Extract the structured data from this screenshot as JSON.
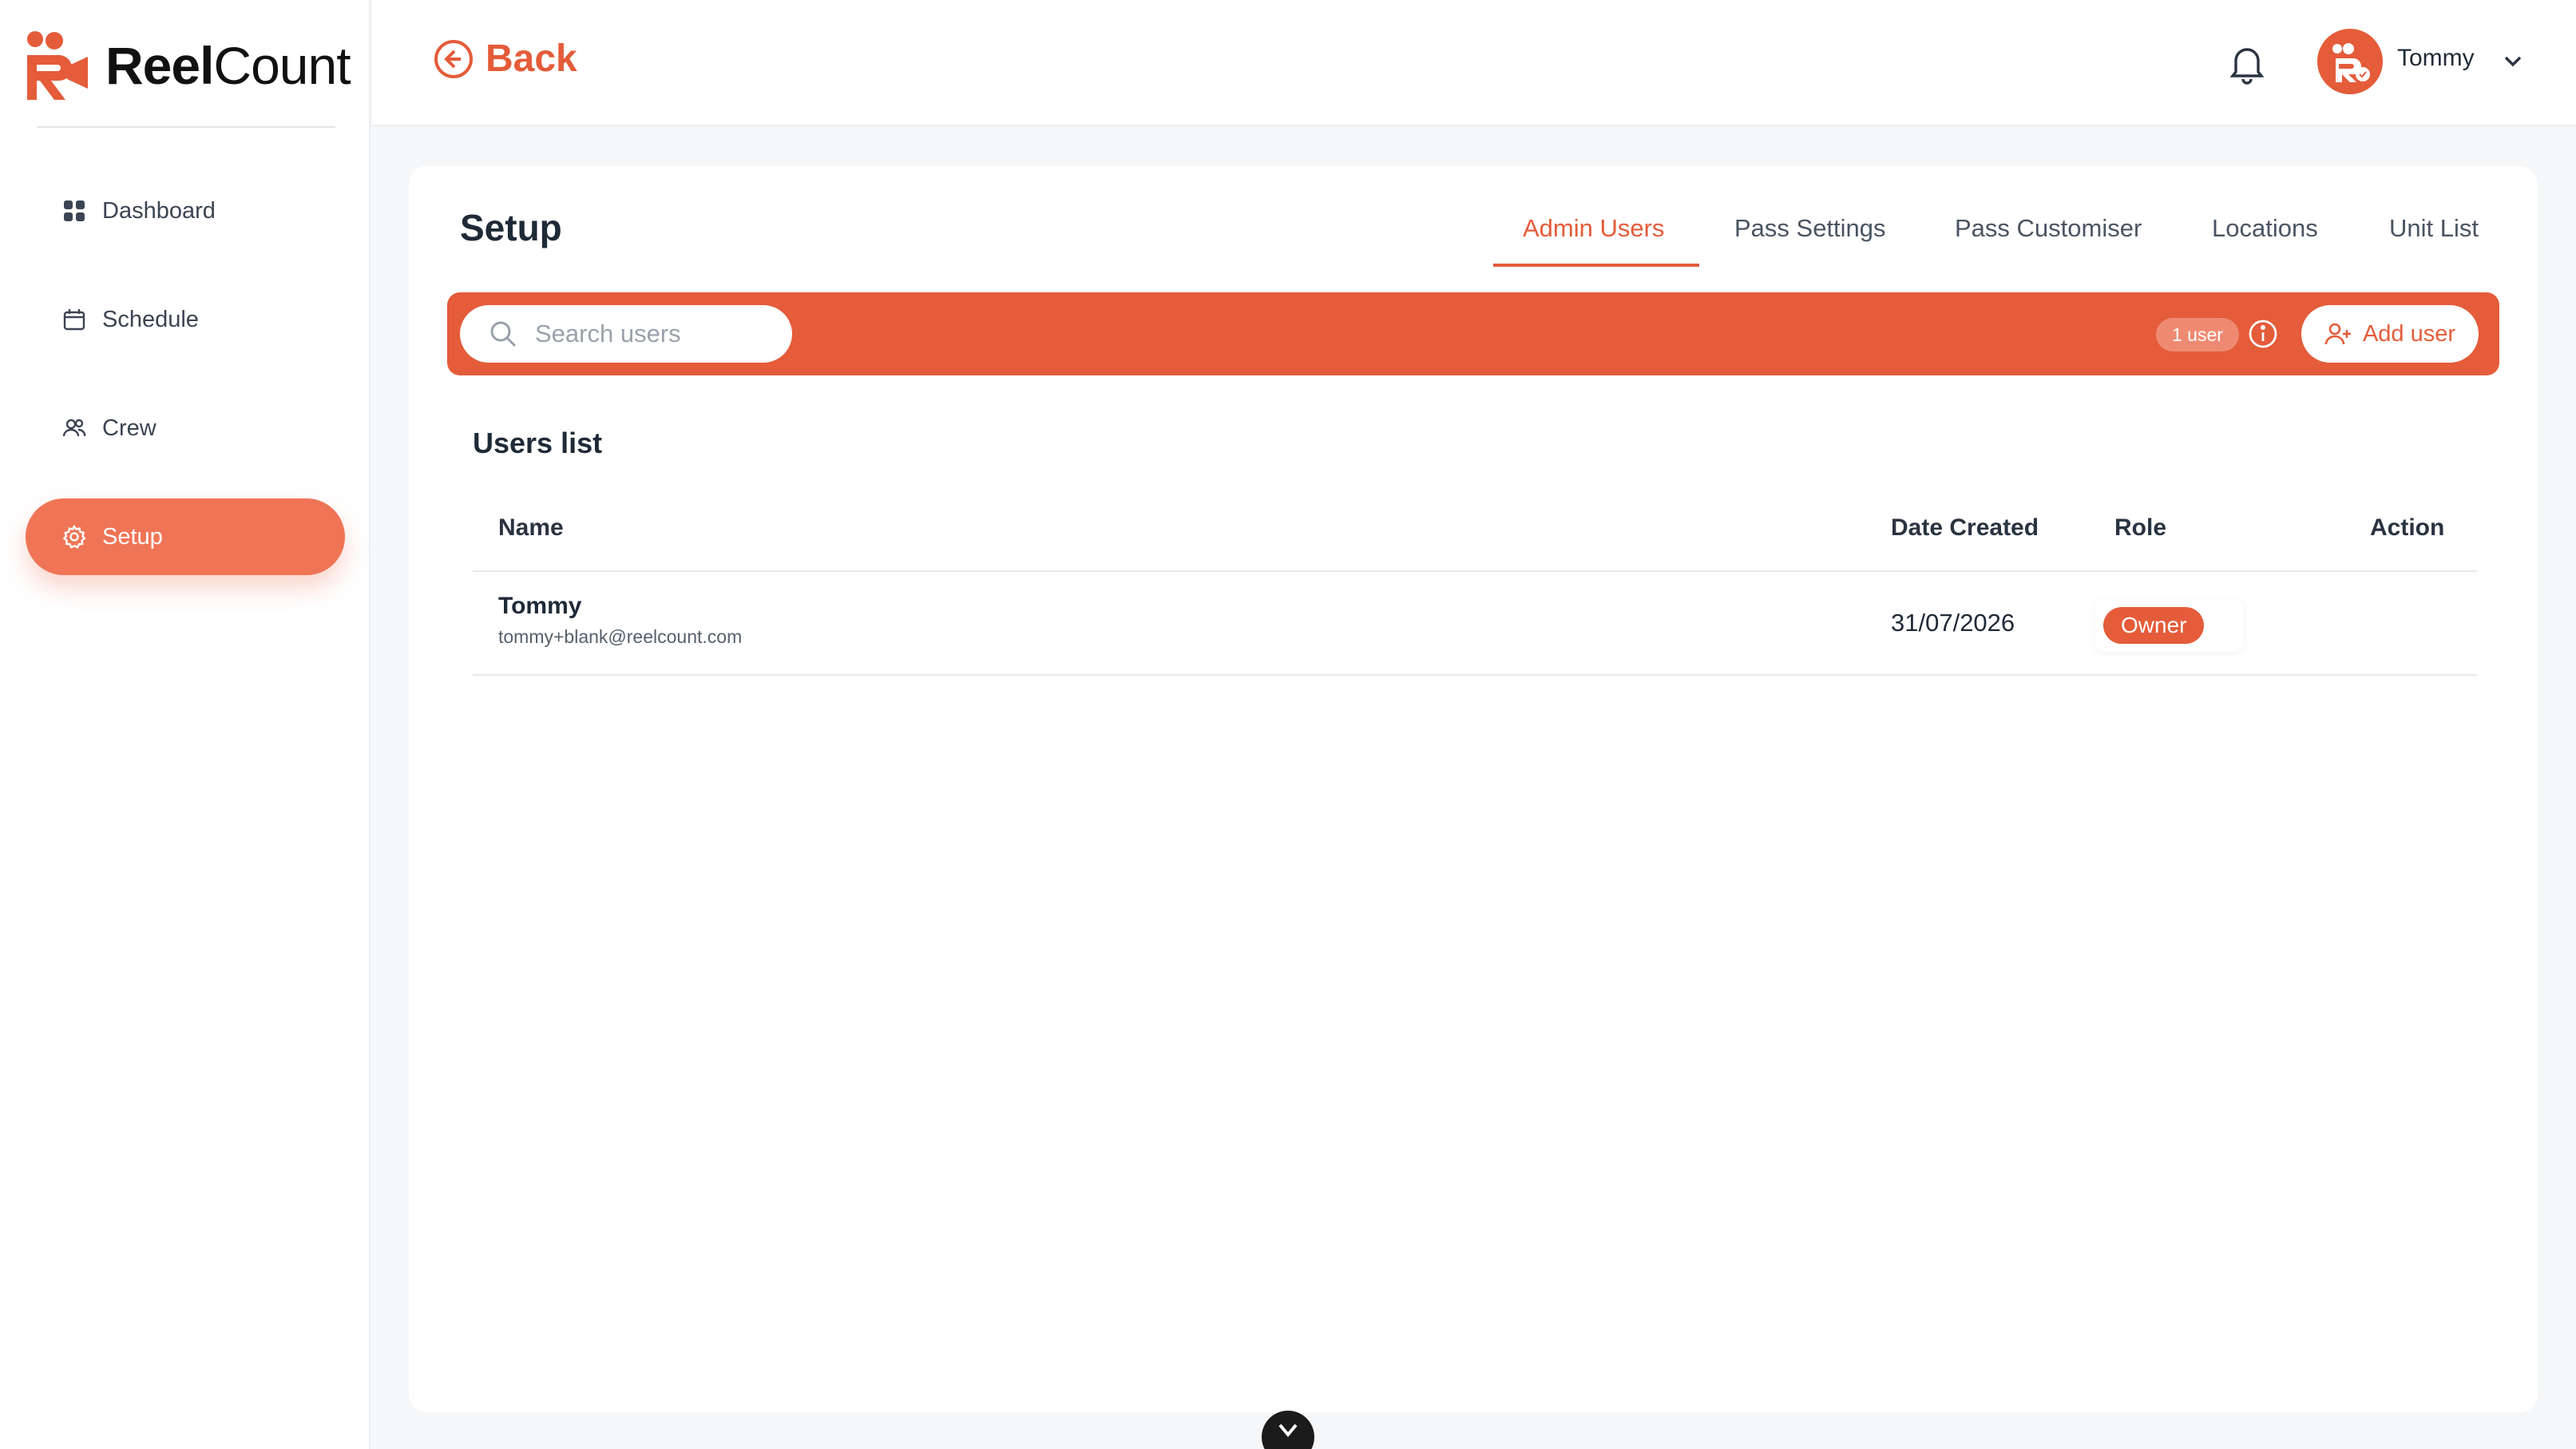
{
  "app": {
    "logo_text_bold": "Reel",
    "logo_text_light": "Count",
    "accent_color": "#e45c3a"
  },
  "sidebar": {
    "items": [
      {
        "label": "Dashboard",
        "icon": "grid-icon"
      },
      {
        "label": "Schedule",
        "icon": "calendar-icon"
      },
      {
        "label": "Crew",
        "icon": "users-icon"
      },
      {
        "label": "Setup",
        "icon": "gear-icon",
        "active": true
      }
    ]
  },
  "header": {
    "back_label": "Back",
    "user_name": "Tommy"
  },
  "page": {
    "title": "Setup",
    "tabs": [
      {
        "label": "Admin Users",
        "active": true
      },
      {
        "label": "Pass Settings"
      },
      {
        "label": "Pass Customiser"
      },
      {
        "label": "Locations"
      },
      {
        "label": "Unit List"
      }
    ]
  },
  "toolbar": {
    "search_placeholder": "Search users",
    "search_value": "",
    "count_label": "1 user",
    "add_user_label": "Add user"
  },
  "users_list": {
    "title": "Users list",
    "columns": [
      "Name",
      "Date Created",
      "Role",
      "Action"
    ],
    "rows": [
      {
        "name": "Tommy",
        "email": "tommy+blank@reelcount.com",
        "date_created": "31/07/2026",
        "role": "Owner"
      }
    ]
  }
}
